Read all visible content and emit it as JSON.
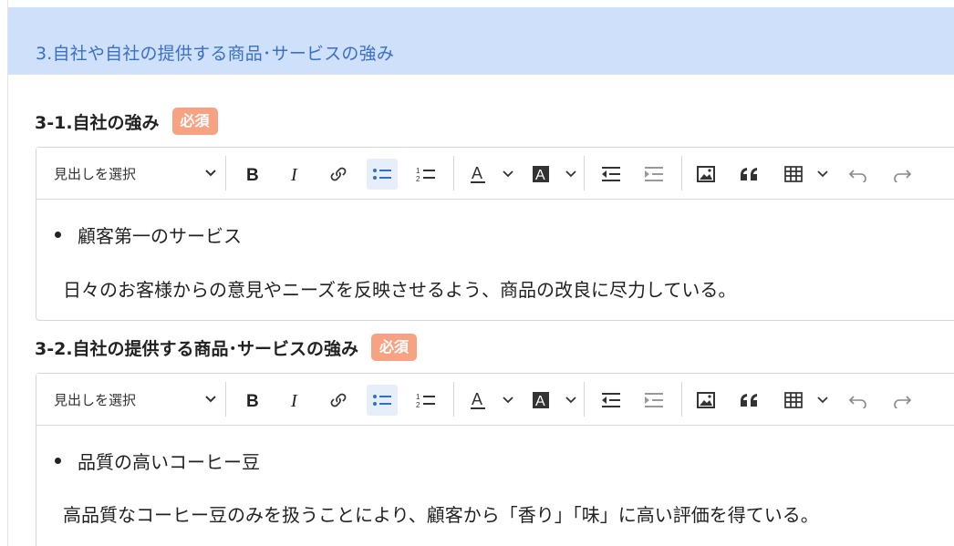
{
  "section": {
    "title": "3.自社や自社の提供する商品･サービスの強み"
  },
  "required_badge": "必須",
  "toolbar": {
    "heading_select_label": "見出しを選択",
    "icons": [
      "bold-icon",
      "italic-icon",
      "link-icon",
      "bulleted-list-icon",
      "numbered-list-icon",
      "font-color-icon",
      "highlight-icon",
      "outdent-icon",
      "indent-icon",
      "image-icon",
      "quote-icon",
      "table-icon",
      "undo-icon",
      "redo-icon"
    ]
  },
  "fields": [
    {
      "label": "3-1.自社の強み",
      "bullet": "顧客第一のサービス",
      "paragraph": "日々のお客様からの意見やニーズを反映させるよう、商品の改良に尽力している。"
    },
    {
      "label": "3-2.自社の提供する商品･サービスの強み",
      "bullet": "品質の高いコーヒー豆",
      "paragraph": "高品質なコーヒー豆のみを扱うことにより、顧客から「香り」「味」に高い評価を得ている。"
    }
  ],
  "colors": {
    "header_bg": "#cfe0fb",
    "header_text": "#3a6fc7",
    "badge_bg": "#f7a383",
    "active_button_bg": "#e6eef9"
  }
}
